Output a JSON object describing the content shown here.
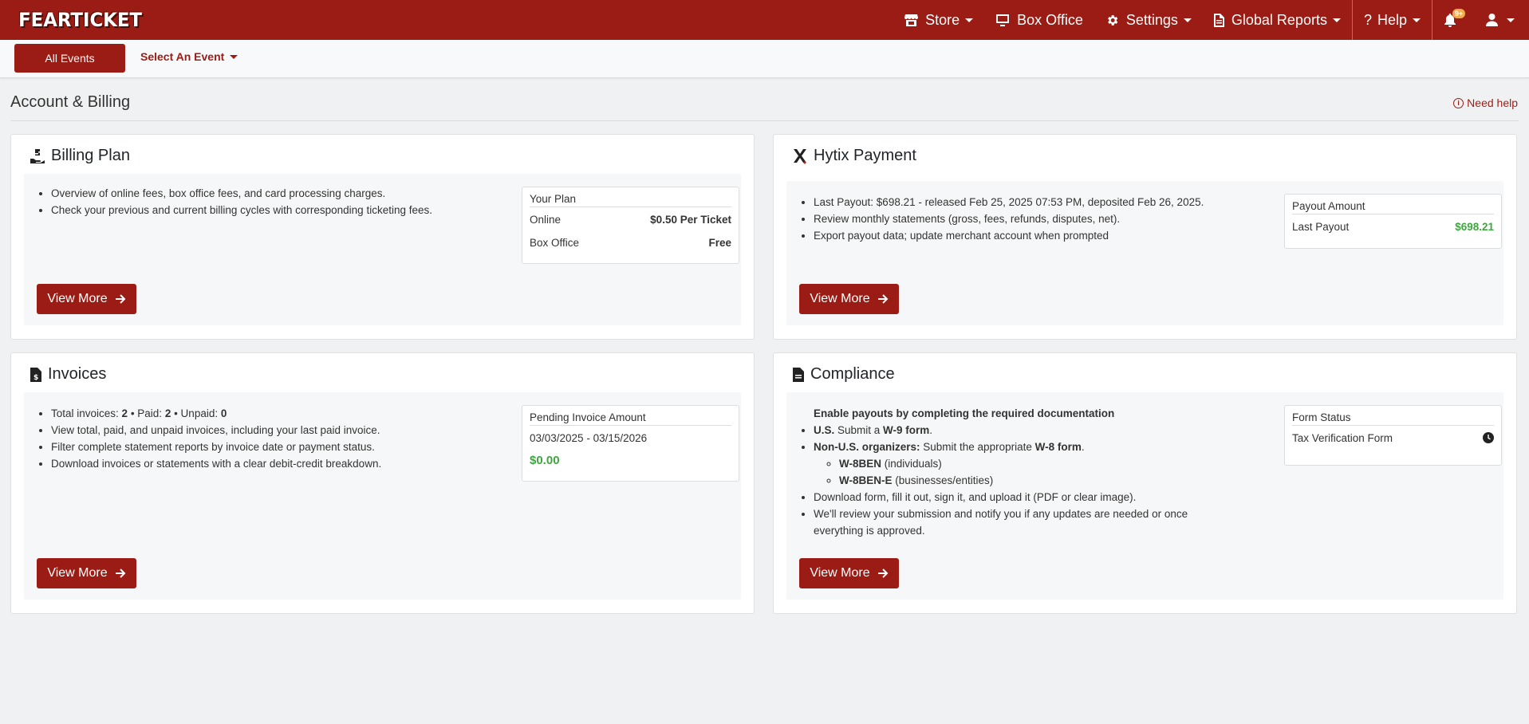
{
  "brand": {
    "name": "FEARTICKET"
  },
  "nav": {
    "store": "Store",
    "box_office": "Box Office",
    "settings": "Settings",
    "global_reports": "Global Reports",
    "help": "Help",
    "notifications_badge": "9+"
  },
  "subbar": {
    "all_events": "All Events",
    "select_event": "Select An Event"
  },
  "page": {
    "title": "Account & Billing",
    "need_help": "Need help"
  },
  "billing_plan": {
    "title": "Billing Plan",
    "bullets": [
      "Overview of online fees, box office fees, and card processing charges.",
      "Check your previous and current billing cycles with corresponding ticketing fees."
    ],
    "box": {
      "heading": "Your Plan",
      "online_label": "Online",
      "online_value": "$0.50 Per Ticket",
      "box_office_label": "Box Office",
      "box_office_value": "Free"
    },
    "button": "View More"
  },
  "hytix_payment": {
    "title": "Hytix Payment",
    "bullets": [
      "Last Payout: $698.21 - released Feb 25, 2025 07:53 PM, deposited Feb 26, 2025.",
      "Review monthly statements (gross, fees, refunds, disputes, net).",
      "Export payout data; update merchant account when prompted"
    ],
    "box": {
      "heading": "Payout Amount",
      "last_payout_label": "Last Payout",
      "last_payout_value": "$698.21"
    },
    "button": "View More"
  },
  "invoices": {
    "title": "Invoices",
    "summary": {
      "total_label": "Total invoices: ",
      "total": "2",
      "paid_label": " • Paid: ",
      "paid": "2",
      "unpaid_label": " • Unpaid: ",
      "unpaid": "0"
    },
    "bullets": [
      "View total, paid, and unpaid invoices, including your last paid invoice.",
      "Filter complete statement reports by invoice date or payment status.",
      "Download invoices or statements with a clear debit-credit breakdown."
    ],
    "box": {
      "heading": "Pending Invoice Amount",
      "range": "03/03/2025 - 03/15/2026",
      "amount": "$0.00"
    },
    "button": "View More"
  },
  "compliance": {
    "title": "Compliance",
    "intro": "Enable payouts by completing the required documentation",
    "us": {
      "label": "U.S.",
      "text_a": " Submit a ",
      "form": "W-9 form",
      "text_b": "."
    },
    "non_us": {
      "label": "Non-U.S. organizers:",
      "text_a": " Submit the appropriate ",
      "form": "W-8 form",
      "text_b": "."
    },
    "sub_items": [
      {
        "form": "W-8BEN",
        "desc": " (individuals)"
      },
      {
        "form": "W-8BEN-E",
        "desc": " (businesses/entities)"
      }
    ],
    "bullets": [
      "Download form, fill it out, sign it, and upload it (PDF or clear image).",
      "We'll review your submission and notify you if any updates are needed or once everything is approved."
    ],
    "box": {
      "heading": "Form Status",
      "form_label": "Tax Verification Form"
    },
    "button": "View More"
  },
  "colors": {
    "brand": "#9b1c14",
    "success": "#3ea63f",
    "warning_badge": "#f0ad4e"
  }
}
